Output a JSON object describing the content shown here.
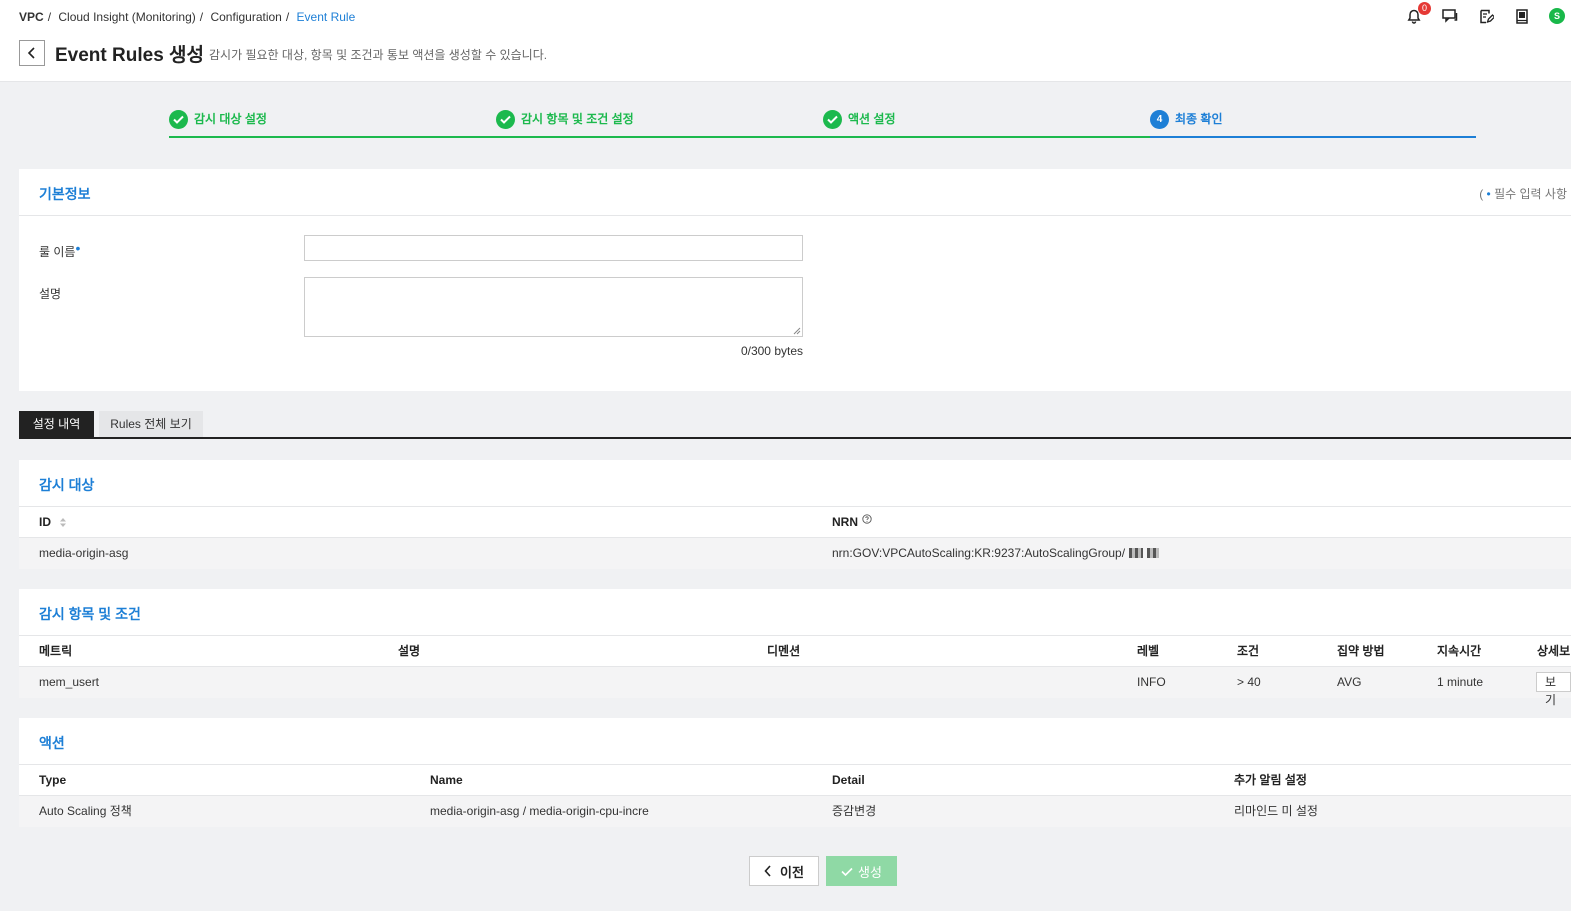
{
  "breadcrumb": [
    "VPC",
    "Cloud Insight (Monitoring)",
    "Configuration",
    "Event Rule"
  ],
  "breadcrumb_sep": "/",
  "header": {
    "notification_count": "0",
    "avatar_letter": "S",
    "icons": [
      "bell-icon",
      "chat-icon",
      "edit-note-icon",
      "book-icon",
      "avatar"
    ]
  },
  "page": {
    "title": "Event Rules 생성",
    "description": "감시가 필요한 대상, 항목 및 조건과 통보 액션을 생성할 수 있습니다."
  },
  "stepper": {
    "steps": [
      {
        "label": "감시 대상 설정",
        "state": "done"
      },
      {
        "label": "감시 항목 및 조건 설정",
        "state": "done"
      },
      {
        "label": "액션 설정",
        "state": "done"
      },
      {
        "label": "최종 확인",
        "state": "active",
        "number": "4"
      }
    ]
  },
  "basic_info": {
    "title": "기본정보",
    "required_note_open": "(",
    "required_note_dot": "•",
    "required_note_text": "필수 입력 사항",
    "rule_name_label": "룰 이름",
    "rule_name_value": "",
    "description_label": "설명",
    "description_value": "",
    "byte_counter": "0/300 bytes"
  },
  "tabs": [
    "설정 내역",
    "Rules 전체 보기"
  ],
  "monitoring_target": {
    "title": "감시 대상",
    "columns": [
      "ID",
      "NRN"
    ],
    "rows": [
      {
        "id": "media-origin-asg",
        "nrn": "nrn:GOV:VPCAutoScaling:KR:9237:AutoScalingGroup/"
      }
    ]
  },
  "monitoring_items": {
    "title": "감시 항목 및 조건",
    "columns": [
      "메트릭",
      "설명",
      "디멘션",
      "레벨",
      "조건",
      "집약 방법",
      "지속시간",
      "상세보"
    ],
    "rows": [
      {
        "metric": "mem_usert",
        "description": "",
        "dimension": "",
        "level": "INFO",
        "condition": "> 40",
        "aggregation": "AVG",
        "duration": "1 minute",
        "detail_button": "보기"
      }
    ]
  },
  "actions": {
    "title": "액션",
    "columns": [
      "Type",
      "Name",
      "Detail",
      "추가 알림 설정"
    ],
    "rows": [
      {
        "type": "Auto Scaling 정책",
        "name": "media-origin-asg / media-origin-cpu-incre",
        "detail": "증감변경",
        "extra": "리마인드 미 설정"
      }
    ]
  },
  "buttons": {
    "prev": "이전",
    "create": "생성"
  },
  "colors": {
    "accent_blue": "#1d7fd6",
    "success_green": "#1cb94d",
    "disabled_green": "#8fd9a5",
    "badge_red": "#e53935"
  }
}
